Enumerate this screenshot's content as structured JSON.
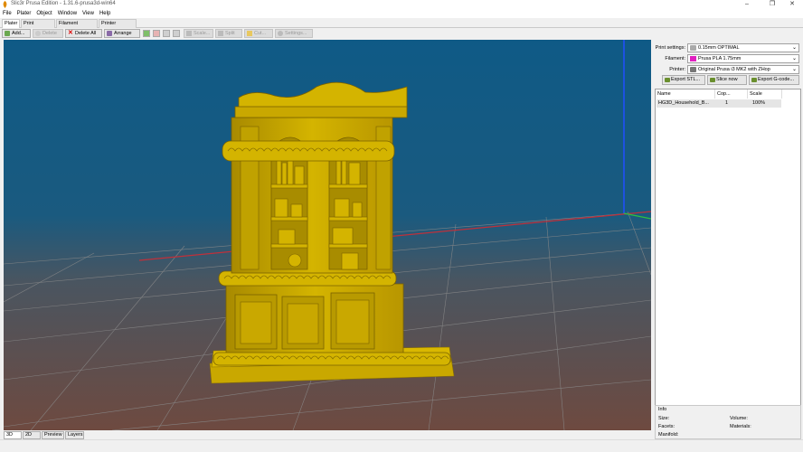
{
  "window": {
    "title": "Slic3r Prusa Edition - 1.31.6-prusa3d-win64",
    "minimize": "–",
    "maximize": "❐",
    "close": "✕"
  },
  "menu": [
    "File",
    "Plater",
    "Object",
    "Window",
    "View",
    "Help"
  ],
  "tabs": [
    "Plater",
    "Print Settings",
    "Filament Settings",
    "Printer Settings"
  ],
  "toolbar": {
    "add": "Add...",
    "delete": "Delete",
    "delete_all": "Delete All",
    "arrange": "Arrange",
    "scale": "Scale...",
    "split": "Split",
    "cut": "Cut...",
    "settings": "Settings..."
  },
  "view_tabs": [
    "3D",
    "2D",
    "Preview",
    "Layers"
  ],
  "settings": {
    "print_label": "Print settings:",
    "print_value": "0.15mm OPTIMAL",
    "filament_label": "Filament:",
    "filament_value": "Prusa PLA 1.75mm",
    "filament_color": "#e020c0",
    "printer_label": "Printer:",
    "printer_value": "Original Prusa i3 MK2 with ZHop"
  },
  "actions": {
    "export_stl": "Export STL...",
    "slice_now": "Slice now",
    "export_gcode": "Export G-code..."
  },
  "object_list": {
    "columns": [
      "Name",
      "Cop...",
      "Scale"
    ],
    "rows": [
      {
        "name": "HG3D_Household_B...",
        "copies": "1",
        "scale": "100%"
      }
    ]
  },
  "info": {
    "title": "Info",
    "size_label": "Size:",
    "volume_label": "Volume:",
    "facets_label": "Facets:",
    "materials_label": "Materials:",
    "manifold_label": "Manifold:"
  },
  "colors": {
    "model": "#c9a800",
    "bed_grid": "#8a8a8a",
    "bg_top": "#0f5a86",
    "bg_bottom": "#6e4a40"
  }
}
